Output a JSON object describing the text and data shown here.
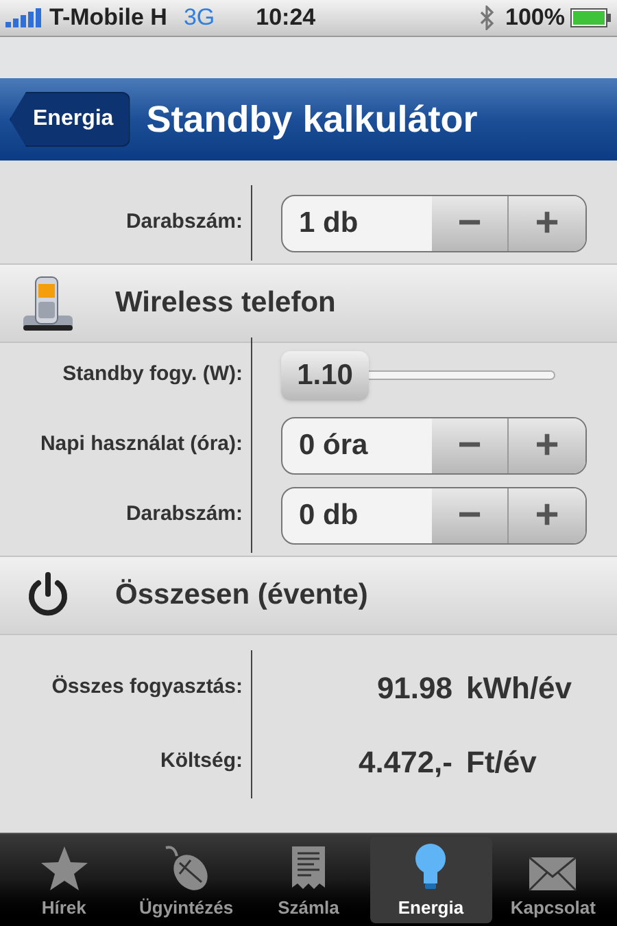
{
  "status_bar": {
    "carrier": "T-Mobile H",
    "network": "3G",
    "time": "10:24",
    "battery": "100%"
  },
  "nav_bar": {
    "back": "Energia",
    "title": "Standby kalkulátor"
  },
  "sections": [
    {
      "kind": "rows",
      "rows": [
        {
          "kind": "stepper",
          "label": "Darabszám:",
          "value": "1 db",
          "minus": "−",
          "plus": "+"
        }
      ]
    },
    {
      "kind": "header",
      "title": "Wireless telefon"
    },
    {
      "kind": "rows",
      "rows": [
        {
          "kind": "slider",
          "label": "Standby fogy. (W):",
          "value": "1.10",
          "level": 0
        },
        {
          "kind": "stepper",
          "label": "Napi használat (óra):",
          "value": "0 óra",
          "minus": "−",
          "plus": "+"
        },
        {
          "kind": "stepper",
          "label": "Darabszám:",
          "value": "0 db",
          "minus": "−",
          "plus": "+"
        }
      ]
    },
    {
      "kind": "header",
      "title": "Összesen (évente)"
    },
    {
      "kind": "totals",
      "rows": [
        {
          "label": "Összes fogyasztás:",
          "value": "91.98",
          "unit": "kWh/év"
        },
        {
          "label": "Költség:",
          "value": "4.472,-",
          "unit": "Ft/év"
        }
      ]
    }
  ],
  "tabs": [
    {
      "label": "Hírek",
      "selected": false
    },
    {
      "label": "Ügyintézés",
      "selected": false
    },
    {
      "label": "Számla",
      "selected": false
    },
    {
      "label": "Energia",
      "selected": true
    },
    {
      "label": "Kapcsolat",
      "selected": false
    }
  ]
}
